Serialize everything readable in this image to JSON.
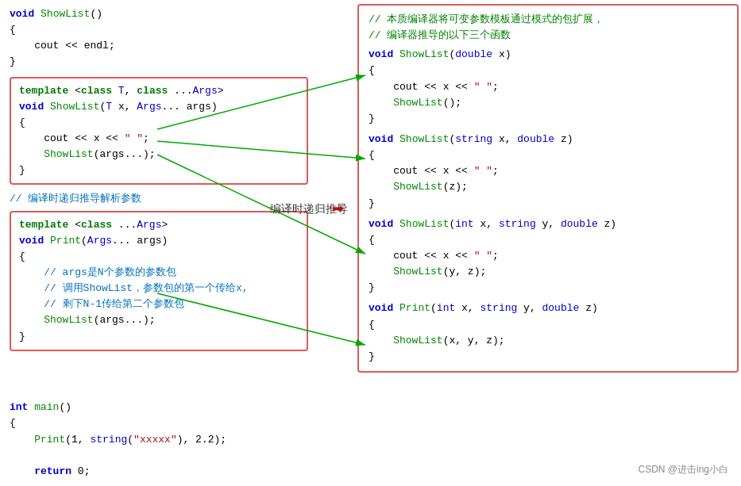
{
  "left_top": {
    "lines": [
      {
        "type": "kw",
        "text": "void"
      },
      {
        "type": "normal",
        "text": " ShowList()"
      },
      {
        "type": "normal",
        "text": "{"
      },
      {
        "type": "normal",
        "text": "    cout << endl;"
      },
      {
        "type": "normal",
        "text": "}"
      }
    ]
  },
  "template_box": {
    "line1": "template <class T, class ...Args>",
    "line2": "void ShowList(T x, Args... args)",
    "line3": "{",
    "line4": "    cout << x << \" \";",
    "line5": "    ShowList(args...);",
    "line6": "}"
  },
  "compile_comment": "// 编译时递归推导解析参数",
  "template_box2": {
    "line1": "template <class ...Args>",
    "line2": "void Print(Args... args)",
    "line3": "{",
    "line4": "    // args是N个参数的参数包",
    "line5": "    // 调用ShowList，参数包的第一个传给x,",
    "line6": "    // 剩下N-1传给第二个参数包",
    "line7": "    ShowList(args...);",
    "line8": "}"
  },
  "bottom_code": {
    "line1": "int main()",
    "line2": "{",
    "line3": "    Print(1, string(\"xxxxx\"), 2.2);",
    "line4": "",
    "line5": "    return 0;"
  },
  "right_box": {
    "comment1": "// 本质编译器将可变参数模板通过模式的包扩展，",
    "comment2": "// 编译器推导的以下三个函数",
    "block1_line1": "void ShowList(double x)",
    "block1_line2": "{",
    "block1_line3": "    cout << x << \" \";",
    "block1_line4": "    ShowList();",
    "block1_line5": "}",
    "block2_line1": "void ShowList(string x, double z)",
    "block2_line2": "{",
    "block2_line3": "    cout << x << \" \";",
    "block2_line4": "    ShowList(z);",
    "block2_line5": "}",
    "block3_line1": "void ShowList(int x, string y, double z)",
    "block3_line2": "{",
    "block3_line3": "    cout << x << \" \";",
    "block3_line4": "    ShowList(y, z);",
    "block3_line5": "}",
    "block4_line1": "void Print(int x, string y, double z)",
    "block4_line2": "{",
    "block4_line3": "    ShowList(x, y, z);",
    "block4_line4": "}"
  },
  "arrow_label": "编译时递归推导",
  "arrow_symbol": "→",
  "watermark": "CSDN @进击ing小白"
}
